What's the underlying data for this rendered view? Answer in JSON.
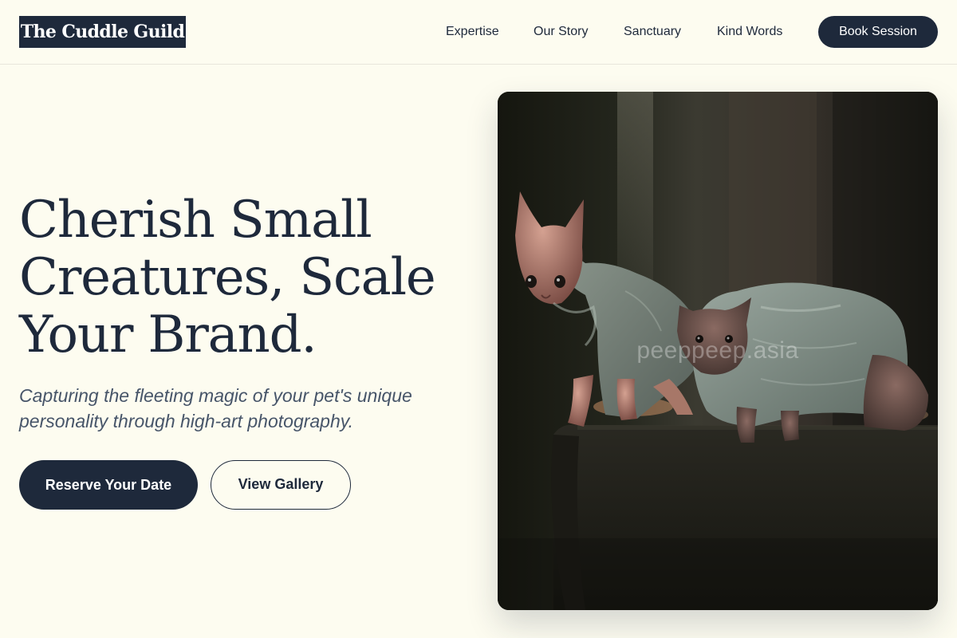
{
  "header": {
    "logo": "The Cuddle Guild",
    "nav": [
      "Expertise",
      "Our Story",
      "Sanctuary",
      "Kind Words"
    ],
    "cta": "Book Session"
  },
  "hero": {
    "headline": [
      "Cherish Small",
      "Creatures, Scale",
      "Your Brand."
    ],
    "subtitle": "Capturing the fleeting magic of your pet's unique personality through high-art photography.",
    "primary_button": "Reserve Your Date",
    "secondary_button": "View Gallery"
  },
  "photo": {
    "subject": "two hairless sphynx cats wearing grey fleece sweaters sitting on a dark sofa",
    "watermark": "peeppeep.asia"
  },
  "colors": {
    "background": "#fdfcf0",
    "navy": "#1e293b",
    "muted_text": "#475569"
  }
}
